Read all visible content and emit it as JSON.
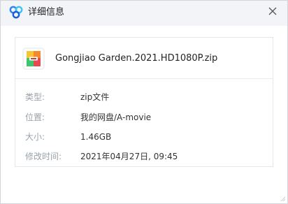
{
  "window": {
    "title": "详细信息",
    "logo_icon": "baidu-netdisk-cloud-icon",
    "close_icon": "close-icon"
  },
  "file": {
    "icon": "zip-archive-icon",
    "name": "Gongjiao Garden.2021.HD1080P.zip"
  },
  "properties": [
    {
      "label": "类型:",
      "value": "zip文件"
    },
    {
      "label": "位置:",
      "value": "我的网盘/A-movie"
    },
    {
      "label": "大小:",
      "value": "1.46GB"
    },
    {
      "label": "修改时间:",
      "value": "2021年04月27日, 09:45"
    }
  ],
  "colors": {
    "titlebar_bg": "#f2f4f7",
    "label_text": "#9aa1aa",
    "value_text": "#333333",
    "logo_blue": "#2f7ff5",
    "logo_cyan": "#39c5f0"
  }
}
